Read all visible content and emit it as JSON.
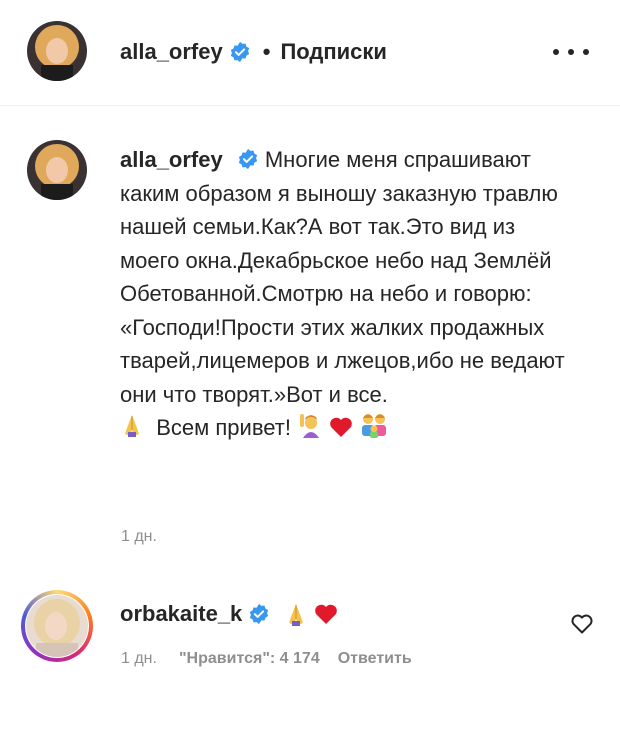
{
  "header": {
    "username": "alla_orfey",
    "separator": "•",
    "follow_label": "Подписки"
  },
  "caption": {
    "username": "alla_orfey",
    "text": "Многие меня спрашивают каким образом я выношу заказную травлю нашей семьи.Как?А вот так.Это вид из моего окна.Декабрьское небо над Землёй Обетованной.Смотрю на небо и говорю: «Господи!Прости этих жалких продажных тварей,лицемеров и лжецов,ибо не ведают они что творят.»Вот и все.",
    "greeting": "Всем привет!",
    "emojis": [
      "praying-hands",
      "person-raising-hand",
      "red-heart",
      "family"
    ],
    "time": "1 дн."
  },
  "comment": {
    "username": "orbakaite_k",
    "emojis": [
      "praying-hands",
      "red-heart"
    ],
    "time": "1 дн.",
    "likes": "\"Нравится\": 4 174",
    "reply_label": "Ответить"
  },
  "colors": {
    "text": "#262626",
    "muted": "#8e8e8e",
    "verified": "#3897f0",
    "heart": "#ed4956"
  }
}
